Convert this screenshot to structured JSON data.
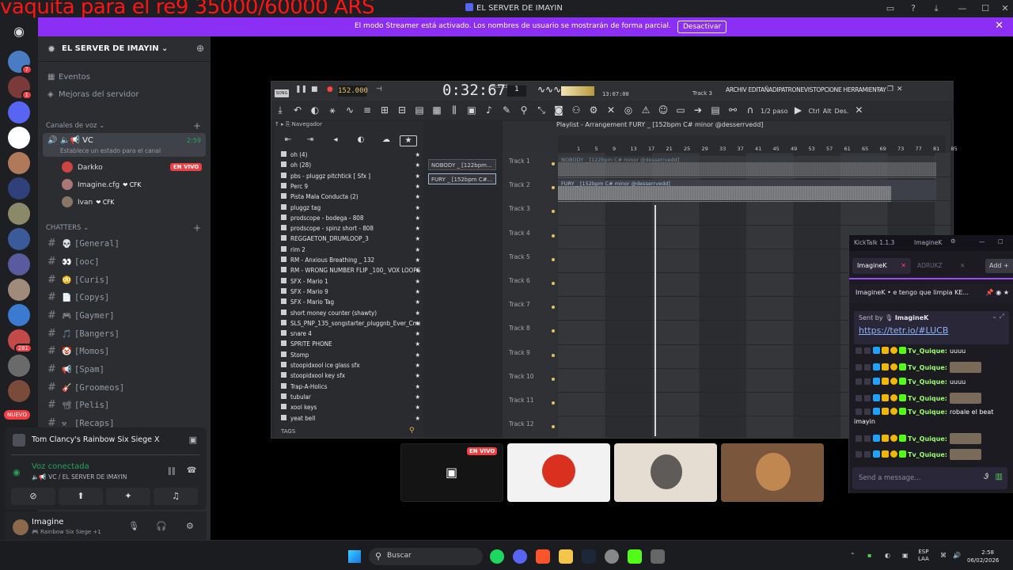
{
  "overlay": {
    "text": "vaquita para el re9 35000/60000 ARS"
  },
  "window": {
    "title": "EL SERVER DE IMAYIN"
  },
  "streamer_bar": {
    "message": "El modo Streamer está activado. Los nombres de usuario se mostrarán de forma parcial.",
    "button": "Desactivar"
  },
  "servers": {
    "badges": [
      "7",
      "1",
      "281"
    ],
    "new_label": "NUEVO"
  },
  "server": {
    "name": "EL SERVER DE IMAYIN",
    "nav": [
      "Eventos",
      "Mejoras del servidor"
    ],
    "voice_category": "Canales de voz",
    "voice_channel": {
      "name": "VC",
      "status": "Establece un estado para el canal",
      "time": "2:59",
      "users": [
        {
          "name": "Darkko",
          "live": "EN VIVO"
        },
        {
          "name": "Imagine.cfg",
          "tag": "CFK"
        },
        {
          "name": "Ivan",
          "tag": "CFK"
        }
      ]
    },
    "text_category": "CHATTERS",
    "text_channels": [
      "[General]",
      "[ooc]",
      "[Curis]",
      "[Copys]",
      "[Gaymer]",
      "[Bangers]",
      "[Momos]",
      "[Spam]",
      "[Groomeos]",
      "[Pelis]",
      "[Recaps]"
    ]
  },
  "game_panel": {
    "game_title": "Tom Clancy's Rainbow Six Siege X",
    "voice_connected": "Voz conectada",
    "voice_path": "VC / EL SERVER DE IMAYIN"
  },
  "user_panel": {
    "name": "Imagine",
    "status": "Rainbow Six Siege +1"
  },
  "fl": {
    "bpm": "152.000",
    "time": "0:32:67",
    "time_label": "M:S:CS",
    "pattern": "1",
    "cpu_time": "13:07:00",
    "track_hint": "Track 3",
    "menu": "ARCHIV EDITAÑADIPATRONEVISTOPCIONE HERRAMIENTAY",
    "step": "1/2 paso",
    "extra_labels": [
      "Ctrl",
      "Alt",
      "Des."
    ],
    "browser_title": "Navegador",
    "browser_items": [
      "oh (4)",
      "oh (28)",
      "pbs - pluggz pitchtick [ Sfx ]",
      "Perc 9",
      "Pista Mala Conducta (2)",
      "pluggz tag",
      "prodscope - bodega - 808",
      "prodscope - spinz short - 808",
      "REGGAETON_DRUMLOOP_3",
      "rim 2",
      "RM - Anxious Breathing _ 132",
      "RM - WRONG NUMBER FLIP _100_ VOX LOOPS",
      "SFX - Mario 1",
      "SFX - Mario 9",
      "SFX - Mario Tag",
      "short money counter (shawty)",
      "SLS_PNP_135_songstarter_pluggnb_Ever_Cmaj",
      "snare 4",
      "SPRITE PHONE",
      "Stomp",
      "stoopidxool ice glass sfx",
      "stoopidxool key sfx",
      "Trap-A-Holics",
      "tubular",
      "xool keys",
      "yeat bell"
    ],
    "tags_label": "TAGS",
    "channels": [
      "NOBODY _ [122bpm...",
      "FURY _ [152bpm C#..."
    ],
    "playlist_title": "Playlist - Arrangement  FURY _ [152bpm C# minor @desserrvedd]",
    "ruler": [
      "1",
      "5",
      "9",
      "13",
      "17",
      "21",
      "25",
      "29",
      "33",
      "37",
      "41",
      "45",
      "49",
      "53",
      "57",
      "61",
      "65",
      "69",
      "73",
      "77",
      "81",
      "85"
    ],
    "tracks": [
      "Track 1",
      "Track 2",
      "Track 3",
      "Track 4",
      "Track 5",
      "Track 6",
      "Track 7",
      "Track 8",
      "Track 9",
      "Track 10",
      "Track 11",
      "Track 12"
    ],
    "clip1": "NOBODY _ [122bpm C# minor @desserrvedd]",
    "clip2": "FURY _ [152bpm C# minor @desserrvedd]"
  },
  "video": {
    "live": "EN VIVO"
  },
  "kicktalk": {
    "app": "KickTalk 1.1.3",
    "user": "ImagineK",
    "tab_active": "ImagineK",
    "tab_other": "ADRUKZ",
    "add": "Add",
    "pinned_user": "ImagineK",
    "pinned_text": "e tengo que limpia KE...",
    "sent_by": "Sent by",
    "sent_user": "ImagineK",
    "link": "https://tetr.io/#LUCB",
    "messages": [
      {
        "user": "Tv_Quique:",
        "text": "uuuu"
      },
      {
        "user": "Tv_Quique:",
        "text": ""
      },
      {
        "user": "Tv_Quique:",
        "text": "uuuu"
      },
      {
        "user": "Tv_Quique:",
        "text": ""
      },
      {
        "user": "Tv_Quique:",
        "text": "robale el beat"
      },
      {
        "user": "",
        "text": "imayin"
      },
      {
        "user": "Tv_Quique:",
        "text": ""
      },
      {
        "user": "Tv_Quique:",
        "text": ""
      }
    ],
    "placeholder": "Send a message..."
  },
  "taskbar": {
    "search": "Buscar",
    "lang": "ESP",
    "lang2": "LAA",
    "time": "2:58",
    "date": "06/02/2026"
  }
}
